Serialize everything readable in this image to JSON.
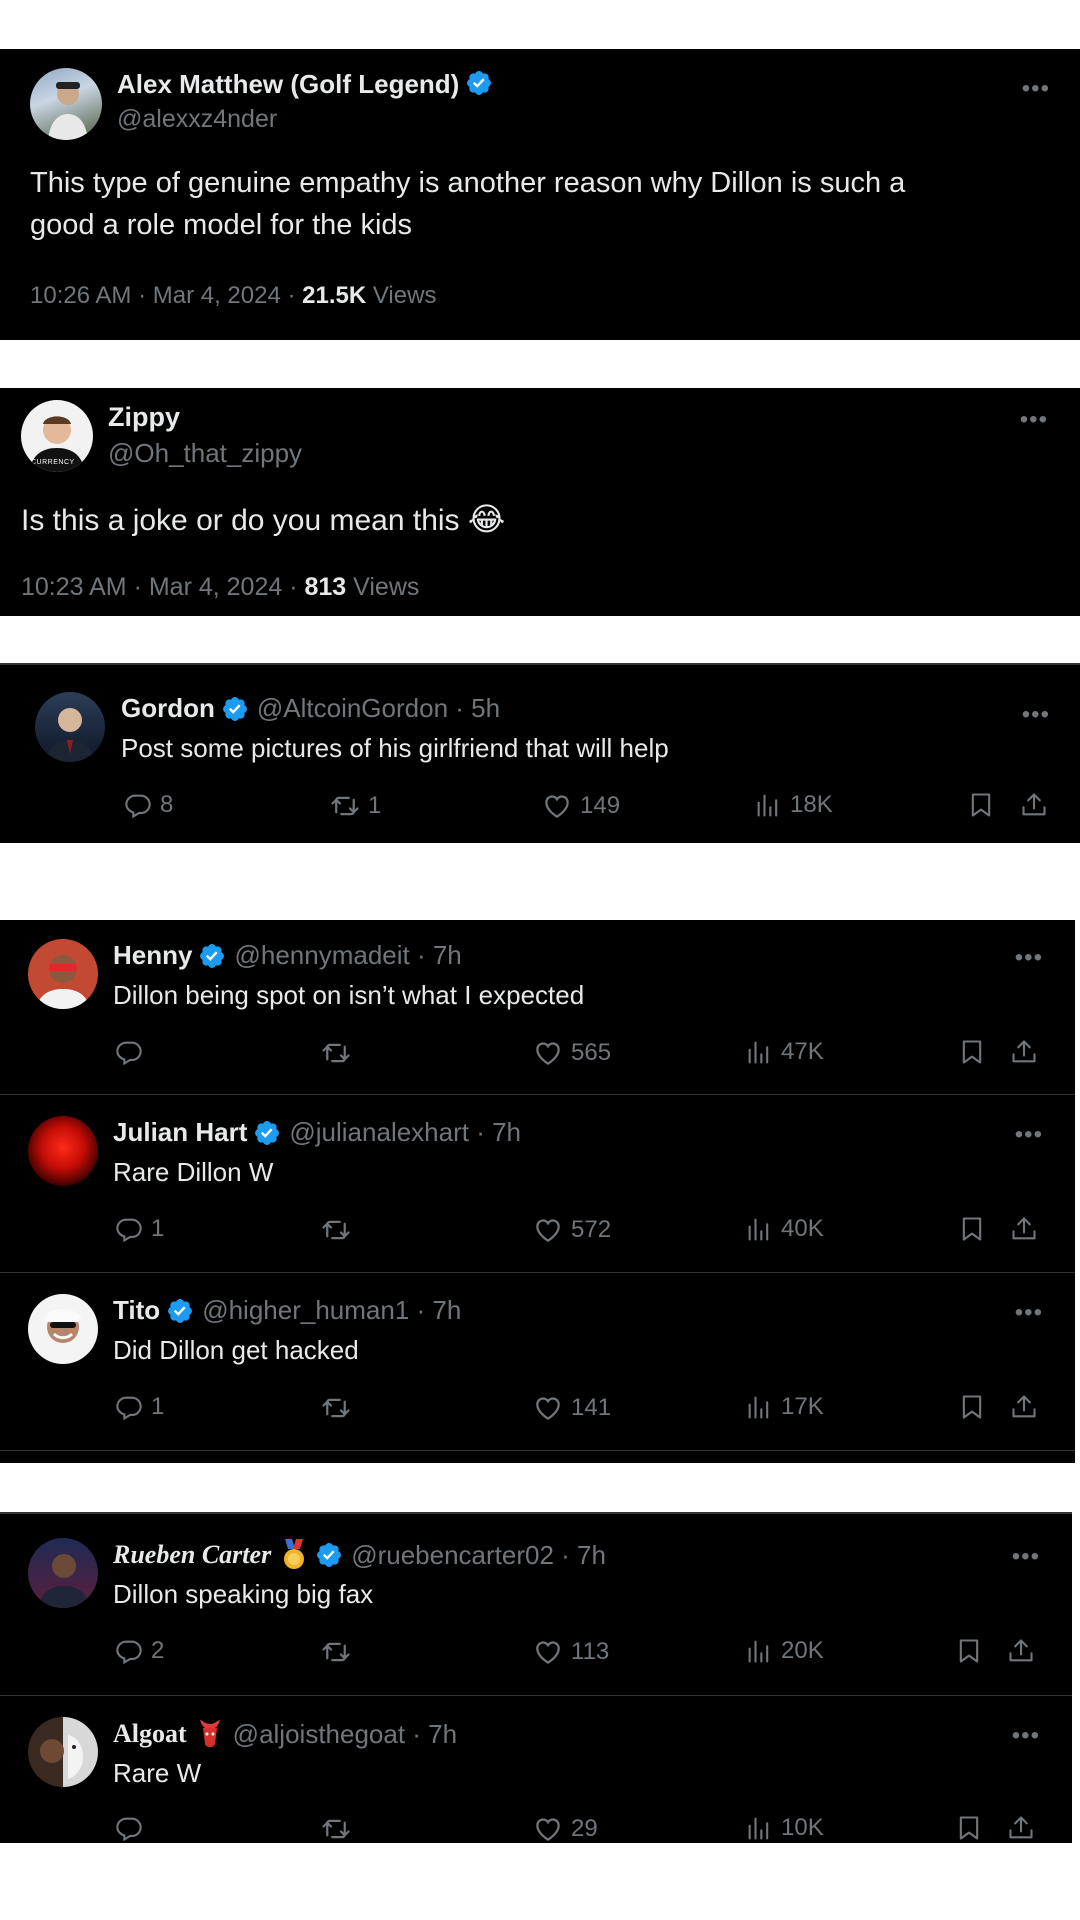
{
  "post1": {
    "name": "Alex Matthew (Golf Legend)",
    "handle": "@alexxz4nder",
    "text_line1": "This type of genuine empathy is another reason why Dillon is such a",
    "text_line2": "good a role model for the kids",
    "time": "10:26 AM · Mar 4, 2024 · ",
    "views_count": "21.5K",
    "views_label": " Views"
  },
  "post2": {
    "name": "Zippy",
    "handle": "@Oh_that_zippy",
    "text": "Is this a joke or do you mean this",
    "emoji": "😂",
    "time": "10:23 AM · Mar 4, 2024 · ",
    "views_count": "813",
    "views_label": " Views",
    "avatar_text": "CURRENCY"
  },
  "reply_gordon": {
    "name": "Gordon",
    "handle": "@AltcoinGordon · 5h",
    "text": "Post some pictures of his girlfriend that will help",
    "replies": "8",
    "reposts": "1",
    "likes": "149",
    "views": "18K"
  },
  "thread1": [
    {
      "name": "Henny",
      "handle": "@hennymadeit · 7h",
      "text": "Dillon being spot on isn’t what I expected",
      "replies": "",
      "reposts": "",
      "likes": "565",
      "views": "47K"
    },
    {
      "name": "Julian Hart",
      "handle": "@julianalexhart · 7h",
      "text": "Rare Dillon W",
      "replies": "1",
      "reposts": "",
      "likes": "572",
      "views": "40K"
    },
    {
      "name": "Tito",
      "handle": "@higher_human1 · 7h",
      "text": "Did Dillon get hacked",
      "replies": "1",
      "reposts": "",
      "likes": "141",
      "views": "17K"
    }
  ],
  "thread2": [
    {
      "name": "Rueben Carter",
      "handle": "@ruebencarter02 · 7h",
      "text": "Dillon speaking big fax",
      "replies": "2",
      "reposts": "",
      "likes": "113",
      "views": "20K"
    },
    {
      "name": "Algoat",
      "handle": "@aljoisthegoat · 7h",
      "text": "Rare W",
      "replies": "",
      "reposts": "",
      "likes": "29",
      "views": "10K"
    }
  ],
  "more_glyph": "•••",
  "colors": {
    "background": "#000000",
    "verified": "#1d9bf0",
    "muted": "#71767b",
    "text": "#e7e9ea"
  },
  "icons": [
    "reply-icon",
    "repost-icon",
    "like-icon",
    "views-icon",
    "bookmark-icon",
    "share-icon",
    "verified-badge-icon",
    "more-icon",
    "medal-icon",
    "goat-emoji-icon"
  ]
}
